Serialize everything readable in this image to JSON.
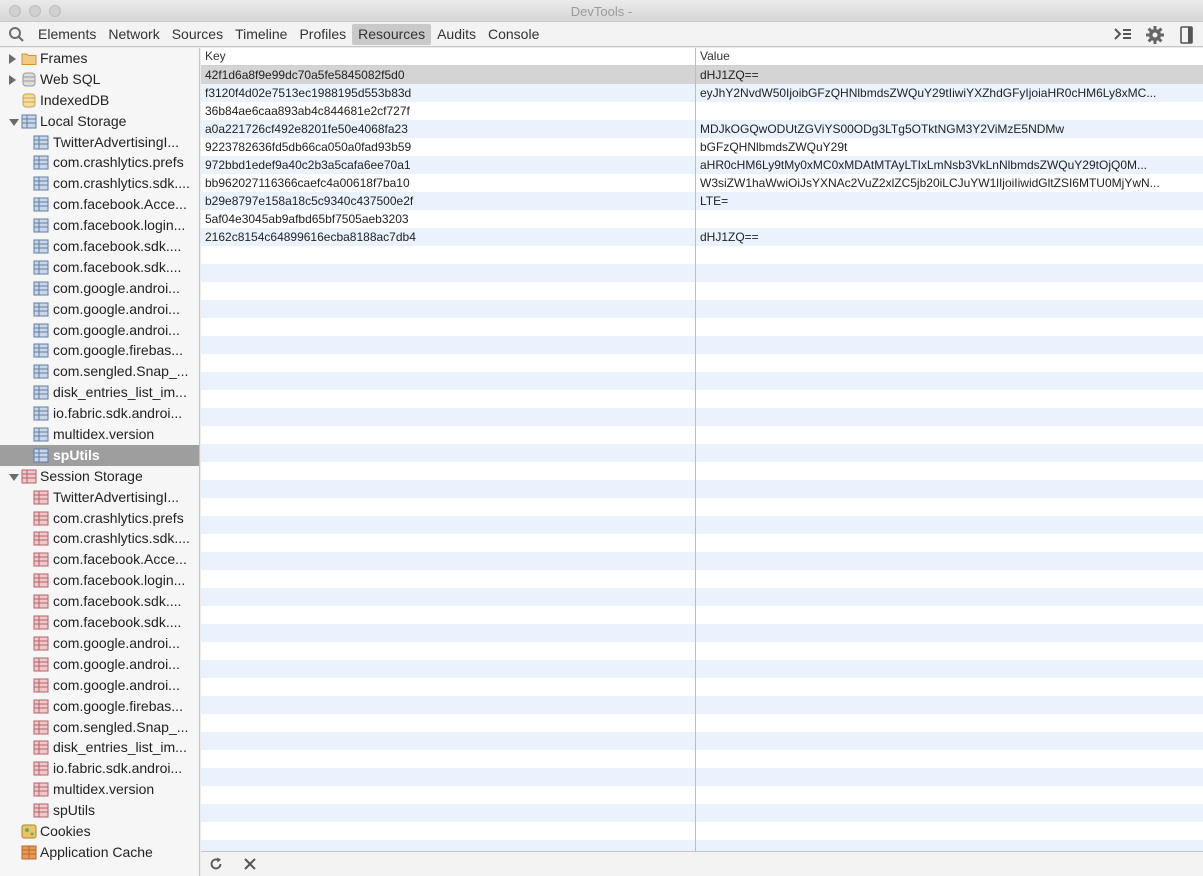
{
  "window": {
    "title": "DevTools -"
  },
  "toolbar": {
    "tabs": [
      "Elements",
      "Network",
      "Sources",
      "Timeline",
      "Profiles",
      "Resources",
      "Audits",
      "Console"
    ],
    "selected_tab": "Resources"
  },
  "sidebar": {
    "frames": "Frames",
    "websql": "Web SQL",
    "indexeddb": "IndexedDB",
    "local_storage": "Local Storage",
    "local_items": [
      "TwitterAdvertisingI...",
      "com.crashlytics.prefs",
      "com.crashlytics.sdk....",
      "com.facebook.Acce...",
      "com.facebook.login...",
      "com.facebook.sdk....",
      "com.facebook.sdk....",
      "com.google.androi...",
      "com.google.androi...",
      "com.google.androi...",
      "com.google.firebas...",
      "com.sengled.Snap_...",
      "disk_entries_list_im...",
      "io.fabric.sdk.androi...",
      "multidex.version",
      "spUtils"
    ],
    "session_storage": "Session Storage",
    "session_items": [
      "TwitterAdvertisingI...",
      "com.crashlytics.prefs",
      "com.crashlytics.sdk....",
      "com.facebook.Acce...",
      "com.facebook.login...",
      "com.facebook.sdk....",
      "com.facebook.sdk....",
      "com.google.androi...",
      "com.google.androi...",
      "com.google.androi...",
      "com.google.firebas...",
      "com.sengled.Snap_...",
      "disk_entries_list_im...",
      "io.fabric.sdk.androi...",
      "multidex.version",
      "spUtils"
    ],
    "cookies": "Cookies",
    "app_cache": "Application Cache"
  },
  "table": {
    "headers": {
      "key": "Key",
      "value": "Value"
    },
    "rows": [
      {
        "key": "42f1d6a8f9e99dc70a5fe5845082f5d0",
        "value": "dHJ1ZQ=="
      },
      {
        "key": "f3120f4d02e7513ec1988195d553b83d",
        "value": "eyJhY2NvdW50IjoibGFzQHNlbmdsZWQuY29tIiwiYXZhdGFyIjoiaHR0cHM6Ly8xMC..."
      },
      {
        "key": "36b84ae6caa893ab4c844681e2cf727f",
        "value": ""
      },
      {
        "key": "a0a221726cf492e8201fe50e4068fa23",
        "value": "MDJkOGQwODUtZGViYS00ODg3LTg5OTktNGM3Y2ViMzE5NDMw"
      },
      {
        "key": "9223782636fd5db66ca050a0fad93b59",
        "value": "bGFzQHNlbmdsZWQuY29t"
      },
      {
        "key": "972bbd1edef9a40c2b3a5cafa6ee70a1",
        "value": "aHR0cHM6Ly9tMy0xMC0xMDAtMTAyLTIxLmNsb3VkLnNlbmdsZWQuY29tOjQ0M..."
      },
      {
        "key": "bb962027116366caefc4a00618f7ba10",
        "value": "W3siZW1haWwiOiJsYXNAc2VuZ2xlZC5jb20iLCJuYW1lIjoiIiwidGltZSI6MTU0MjYwN..."
      },
      {
        "key": "b29e8797e158a18c5c9340c437500e2f",
        "value": "LTE="
      },
      {
        "key": "5af04e3045ab9afbd65bf7505aeb3203",
        "value": ""
      },
      {
        "key": "2162c8154c64899616ecba8188ac7db4",
        "value": "dHJ1ZQ=="
      }
    ],
    "empty_rows": 34
  },
  "colors": {
    "selection": "#9e9e9e",
    "row_alt": "#eaf3fd",
    "local_storage_icon": "#5f7ea6",
    "session_storage_icon": "#b3626b"
  }
}
